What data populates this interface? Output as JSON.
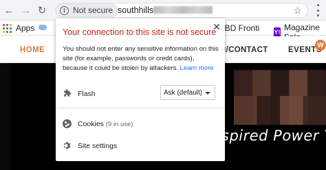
{
  "browser": {
    "security_label": "Not secure",
    "url_visible": "southhills",
    "bookmarks": {
      "apps_label": "Apps",
      "cbd_label": "CBD Fronti",
      "magazine_label": "Magazine Sale"
    }
  },
  "site": {
    "nav_home": "HOME",
    "nav_contact": "N/CONTACT",
    "nav_events": "EVENTS",
    "hero_text": "spired Power Y"
  },
  "popup": {
    "title": "Your connection to this site is not secure",
    "body": "You should not enter any sensitive information on this site (for example, passwords or credit cards), because it could be stolen by attackers.",
    "learn_more": "Learn more",
    "flash_label": "Flash",
    "flash_value": "Ask (default)",
    "cookies_label": "Cookies",
    "cookies_count": "(9 in use)",
    "site_settings_label": "Site settings"
  },
  "colors": {
    "warning_red": "#c5221f",
    "link_blue": "#1a73e8",
    "brand_orange": "#e07a3c"
  },
  "icons": [
    "back-arrow-icon",
    "forward-arrow-icon",
    "reload-icon",
    "info-icon",
    "star-icon",
    "menu-icon",
    "apps-icon",
    "yahoo-icon",
    "wordpress-icon",
    "close-icon",
    "puzzle-icon",
    "cookie-icon",
    "gear-icon"
  ]
}
